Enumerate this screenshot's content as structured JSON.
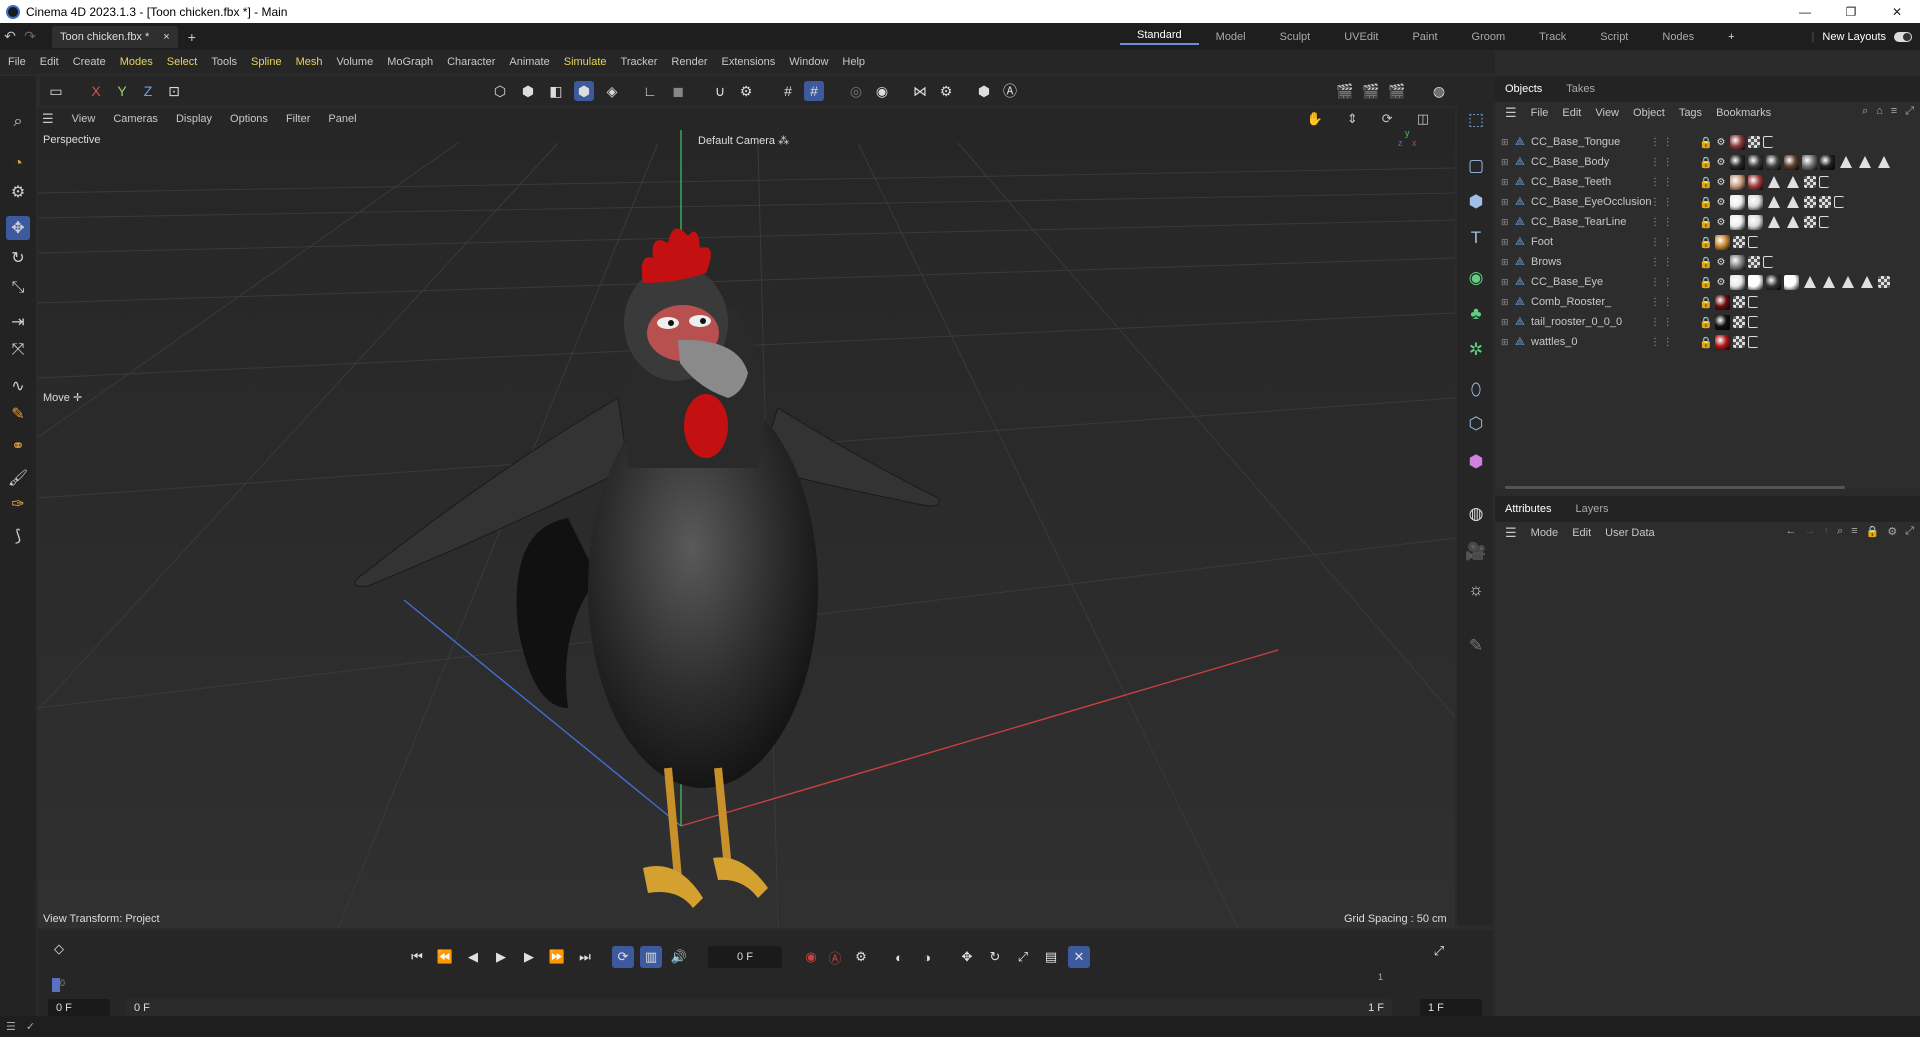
{
  "window": {
    "title": "Cinema 4D 2023.1.3 - [Toon chicken.fbx *] - Main",
    "controls": [
      "—",
      "❐",
      "✕"
    ]
  },
  "tabs": {
    "document_tab": "Toon chicken.fbx *",
    "close_glyph": "×",
    "add_glyph": "+",
    "layouts": [
      "Standard",
      "Model",
      "Sculpt",
      "UVEdit",
      "Paint",
      "Groom",
      "Track",
      "Script",
      "Nodes"
    ],
    "active_layout": "Standard",
    "add_layout_glyph": "+",
    "new_layouts_label": "New Layouts"
  },
  "menu": {
    "items": [
      "File",
      "Edit",
      "Create",
      "Modes",
      "Select",
      "Tools",
      "Spline",
      "Mesh",
      "Volume",
      "MoGraph",
      "Character",
      "Animate",
      "Simulate",
      "Tracker",
      "Render",
      "Extensions",
      "Window",
      "Help"
    ],
    "highlighted": [
      "Modes",
      "Select",
      "Spline",
      "Mesh",
      "Simulate"
    ]
  },
  "toolbar": {
    "axis_x": "X",
    "axis_y": "Y",
    "axis_z": "Z"
  },
  "viewport": {
    "menu": [
      "View",
      "Cameras",
      "Display",
      "Options",
      "Filter",
      "Panel"
    ],
    "projection_label": "Perspective",
    "camera_label": "Default Camera",
    "camera_suffix": "⁂",
    "tool_label": "Move",
    "tool_suffix": "✛",
    "view_transform": "View Transform: Project",
    "grid_spacing": "Grid Spacing : 50 cm",
    "axes": {
      "x": "x",
      "y": "y",
      "z": "z"
    }
  },
  "objects_panel": {
    "tabs": [
      "Objects",
      "Takes"
    ],
    "active_tab": "Objects",
    "menu": [
      "File",
      "Edit",
      "View",
      "Object",
      "Tags",
      "Bookmarks"
    ],
    "objects": [
      {
        "name": "CC_Base_Tongue",
        "tags": [
          "lock",
          "xp",
          "mat:#8a3a3a",
          "check",
          "flag"
        ]
      },
      {
        "name": "CC_Base_Body",
        "tags": [
          "lock",
          "xp",
          "mat:#2a2a2a",
          "mat:#3a3a3a",
          "mat:#444",
          "mat:#5a4030",
          "mat:#777",
          "mat:#222",
          "tri",
          "tri",
          "tri"
        ]
      },
      {
        "name": "CC_Base_Teeth",
        "tags": [
          "lock",
          "xp",
          "mat:#c9a080",
          "mat:#a04040",
          "tri",
          "tri",
          "check",
          "flag"
        ]
      },
      {
        "name": "CC_Base_EyeOcclusion",
        "tags": [
          "lock",
          "xp",
          "mat:#eeeeee",
          "mat:#dddddd",
          "tri",
          "tri",
          "check",
          "check",
          "flag"
        ]
      },
      {
        "name": "CC_Base_TearLine",
        "tags": [
          "lock",
          "xp",
          "mat:#eeeeee",
          "mat:#dddddd",
          "tri",
          "tri",
          "check",
          "flag"
        ]
      },
      {
        "name": "Foot",
        "tags": [
          "lock",
          "mat:#c88a30",
          "check",
          "flag"
        ]
      },
      {
        "name": "Brows",
        "tags": [
          "lock",
          "xp",
          "mat:#888888",
          "check",
          "flag"
        ]
      },
      {
        "name": "CC_Base_Eye",
        "tags": [
          "lock",
          "xp",
          "mat:#e8e8e8",
          "mat:#ffffff",
          "mat:#333333",
          "mat:#ffffff",
          "tri",
          "tri",
          "tri",
          "tri",
          "check"
        ]
      },
      {
        "name": "Comb_Rooster_",
        "tags": [
          "lock",
          "mat:#6a0f0f",
          "check",
          "flag"
        ]
      },
      {
        "name": "tail_rooster_0_0_0",
        "tags": [
          "lock",
          "mat:#111111",
          "check",
          "flag"
        ]
      },
      {
        "name": "wattles_0",
        "tags": [
          "lock",
          "mat:#b01818",
          "check",
          "flag"
        ]
      }
    ]
  },
  "attributes_panel": {
    "tabs": [
      "Attributes",
      "Layers"
    ],
    "active_tab": "Attributes",
    "menu": [
      "Mode",
      "Edit",
      "User Data"
    ]
  },
  "timeline": {
    "current_frame": "0 F",
    "start_field": "0 F",
    "start_field2": "0 F",
    "end_field": "1 F",
    "end_field2": "1 F",
    "ruler_start": "0",
    "ruler_end": "1"
  },
  "colors": {
    "accent": "#3d5a9e",
    "menu_highlight": "#e6d45c",
    "x_axis": "#c84040",
    "y_axis": "#40c860",
    "z_axis": "#4070d0"
  }
}
